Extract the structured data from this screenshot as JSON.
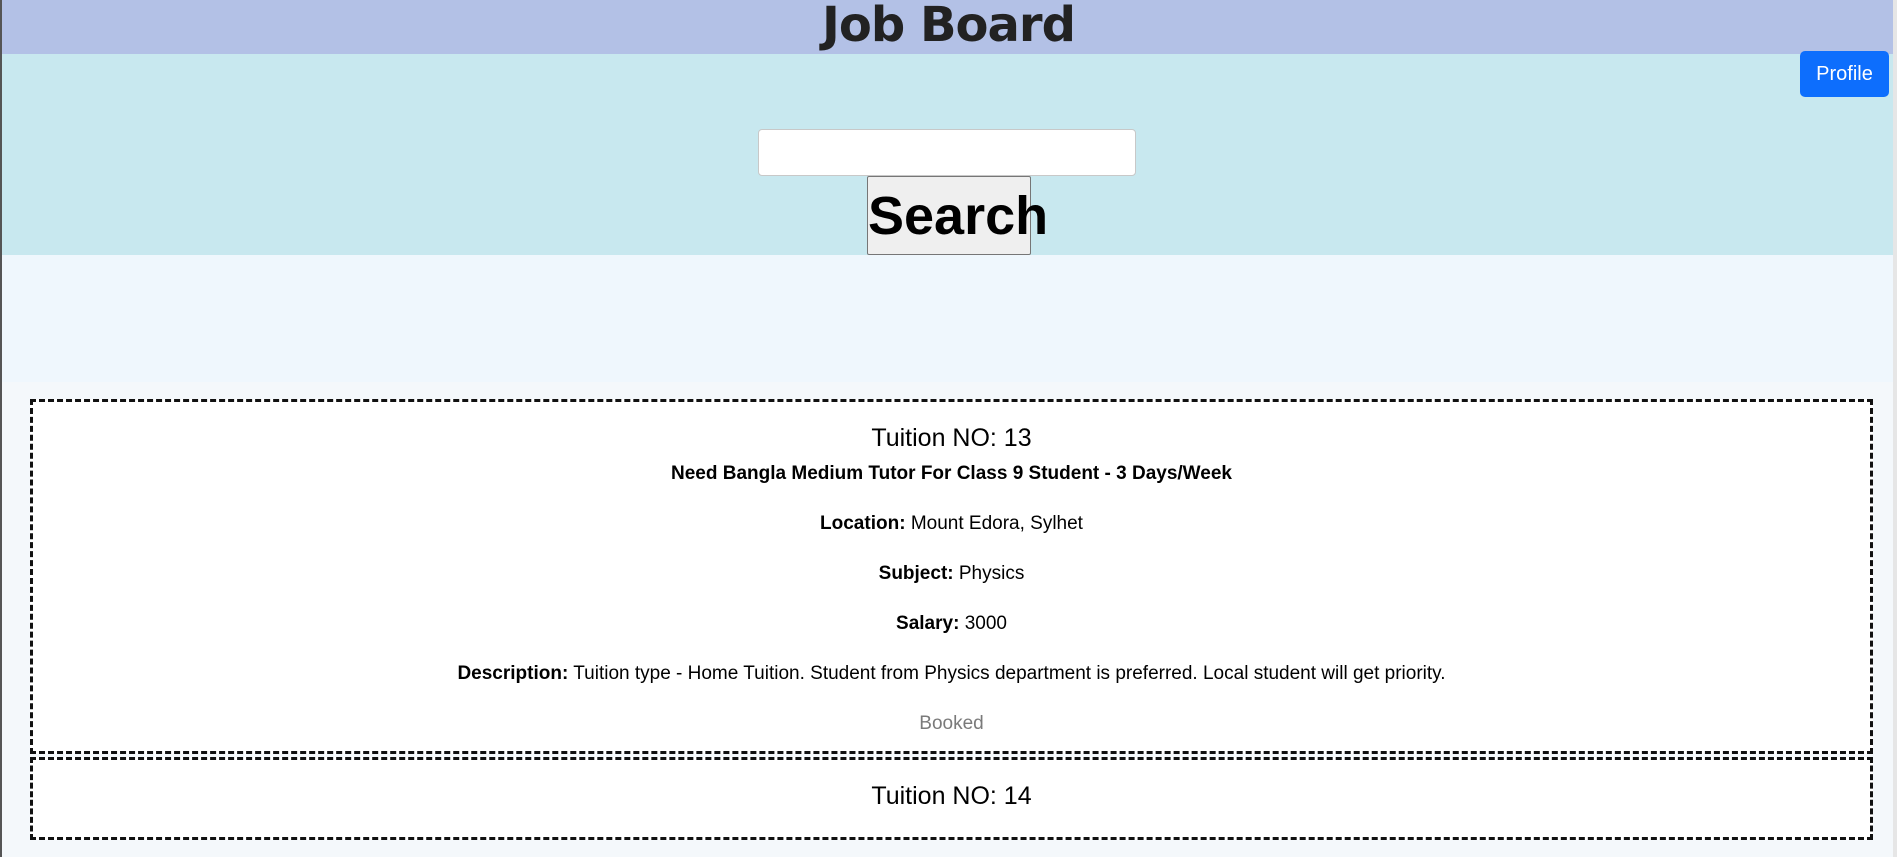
{
  "header": {
    "title": "Job Board"
  },
  "profile_button": {
    "label": "Profile",
    "color": "#0d6efd"
  },
  "search": {
    "input_value": "",
    "button_label": "Search"
  },
  "jobs": [
    {
      "number_label": "Tuition NO: 13",
      "title": "Need Bangla Medium Tutor For Class 9 Student - 3 Days/Week",
      "location_label": "Location:",
      "location": "Mount Edora, Sylhet",
      "subject_label": "Subject:",
      "subject": "Physics",
      "salary_label": "Salary:",
      "salary": "3000",
      "description_label": "Description:",
      "description": "Tuition type - Home Tuition. Student from Physics department is preferred. Local student will get priority.",
      "status": "Booked"
    },
    {
      "number_label": "Tuition NO: 14"
    }
  ],
  "colors": {
    "title_bar": "#b3c1e6",
    "search_band": "#c8e8ef",
    "content_bg": "#eff7fd"
  }
}
